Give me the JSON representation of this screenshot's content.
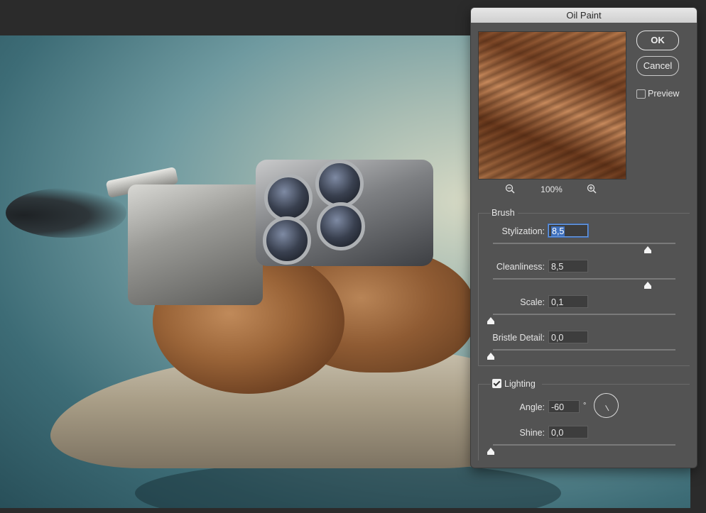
{
  "dialog": {
    "title": "Oil Paint",
    "ok_label": "OK",
    "cancel_label": "Cancel",
    "preview_label": "Preview",
    "preview_checked": false,
    "zoom_level": "100%",
    "brush": {
      "title": "Brush",
      "stylization": {
        "label": "Stylization:",
        "value": "8,5",
        "slider_fraction": 0.85
      },
      "cleanliness": {
        "label": "Cleanliness:",
        "value": "8,5",
        "slider_fraction": 0.85
      },
      "scale": {
        "label": "Scale:",
        "value": "0,1",
        "slider_fraction": 0.0
      },
      "bristle_detail": {
        "label": "Bristle Detail:",
        "value": "0,0",
        "slider_fraction": 0.0
      }
    },
    "lighting": {
      "title": "Lighting",
      "checked": true,
      "angle": {
        "label": "Angle:",
        "value": "-60",
        "unit": "°"
      },
      "shine": {
        "label": "Shine:",
        "value": "0,0",
        "slider_fraction": 0.0
      }
    }
  },
  "icons": {
    "zoom_out": "zoom-out-magnifier-icon",
    "zoom_in": "zoom-in-magnifier-icon"
  }
}
